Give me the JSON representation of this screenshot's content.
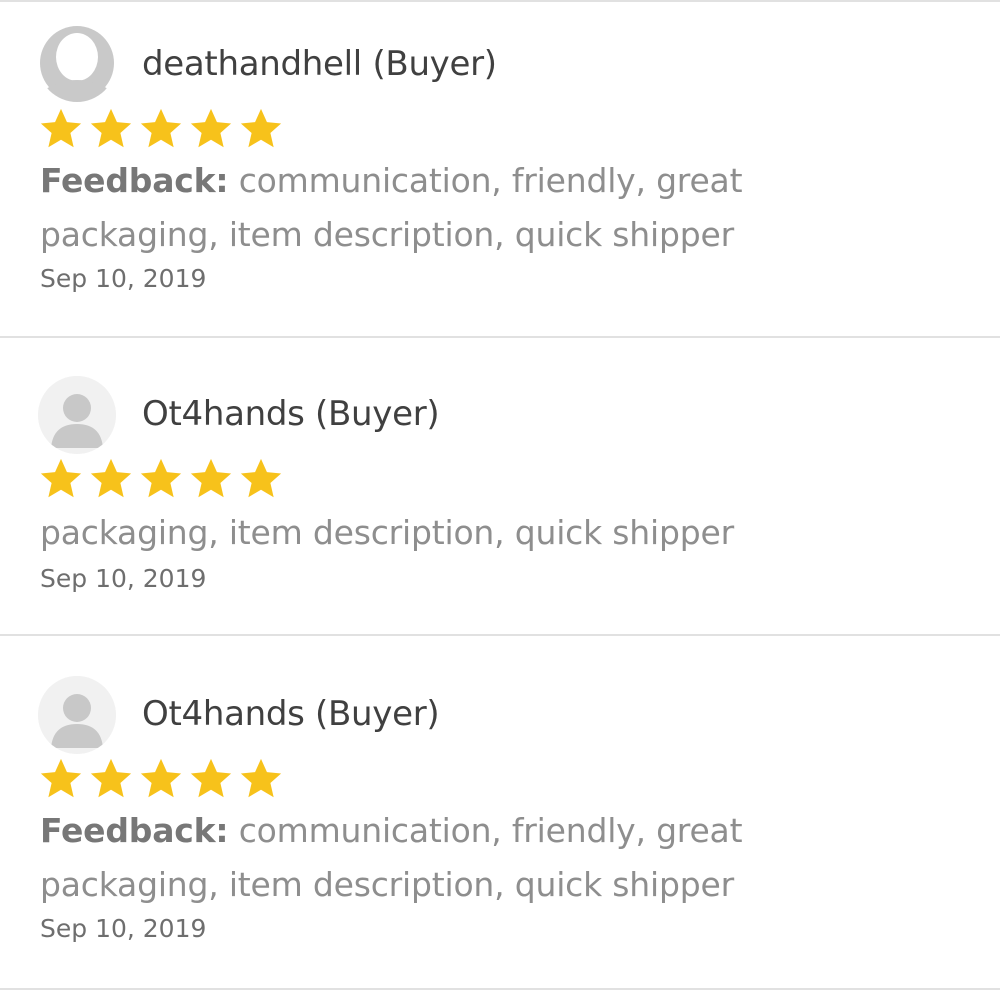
{
  "reviews": [
    {
      "username": "deathandhell (Buyer)",
      "avatar_icon": "user-outline-icon",
      "rating": 5,
      "feedback_label": "Feedback:",
      "feedback_line1": "communication, friendly, great",
      "feedback_line2": "packaging, item description, quick shipper",
      "date": "Sep 10, 2019"
    },
    {
      "username": "Ot4hands (Buyer)",
      "avatar_icon": "user-silhouette-icon",
      "rating": 5,
      "feedback_line2": "packaging, item description, quick shipper",
      "date": "Sep 10, 2019"
    },
    {
      "username": "Ot4hands (Buyer)",
      "avatar_icon": "user-silhouette-icon",
      "rating": 5,
      "feedback_label": "Feedback:",
      "feedback_line1": "communication, friendly, great",
      "feedback_line2": "packaging, item description, quick shipper",
      "date": "Sep 10, 2019"
    }
  ],
  "colors": {
    "star": "#f7c21b",
    "divider": "#e1e1e1",
    "username": "#404040",
    "feedback_text": "#8e8e8e",
    "avatar_bg": "#f1f1f1",
    "avatar_figure": "#c8c8c8"
  }
}
